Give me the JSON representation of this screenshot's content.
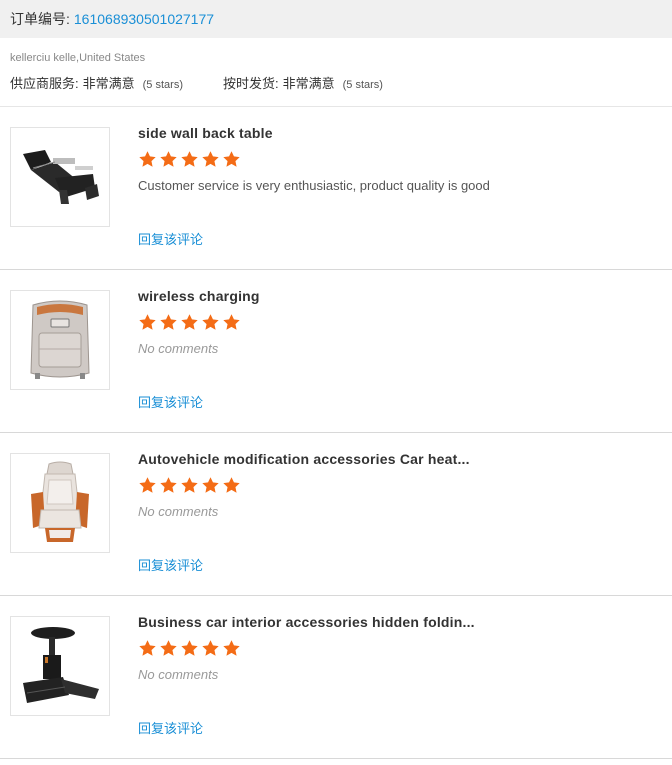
{
  "order": {
    "label": "订单编号:",
    "number": "161068930501027177"
  },
  "buyer": {
    "name": "kellerciu kelle,United States",
    "supplier_service": {
      "label": "供应商服务:",
      "value": "非常满意",
      "stars": "(5 stars)"
    },
    "delivery": {
      "label": "按时发货:",
      "value": "非常满意",
      "stars": "(5 stars)"
    }
  },
  "colors": {
    "accent": "#1a8fd6",
    "star": "#f46c16"
  },
  "reviews": [
    {
      "title": "side wall back table",
      "rating": 5,
      "comment": "Customer service is very enthusiastic, product quality is good",
      "reply_label": "回复该评论",
      "image_icon": "massage-recliner-image"
    },
    {
      "title": "wireless charging",
      "rating": 5,
      "comment": "No comments",
      "reply_label": "回复该评论",
      "image_icon": "seat-back-panel-image"
    },
    {
      "title": "Autovehicle modification accessories Car heat...",
      "rating": 5,
      "comment": "No comments",
      "reply_label": "回复该评论",
      "image_icon": "car-seat-image"
    },
    {
      "title": "Business car interior accessories hidden foldin...",
      "rating": 5,
      "comment": "No comments",
      "reply_label": "回复该评论",
      "image_icon": "folding-table-image"
    }
  ]
}
